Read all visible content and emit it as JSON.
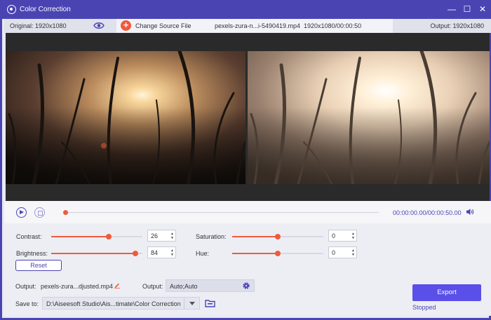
{
  "window": {
    "title": "Color Correction",
    "controls": [
      "—",
      "☐",
      "✕"
    ]
  },
  "infobar": {
    "original_label": "Original: 1920x1080",
    "change_source_label": "Change Source File",
    "file_name": "pexels-zura-n...i-5490419.mp4",
    "file_info": "1920x1080/00:00:50",
    "output_label": "Output: 1920x1080"
  },
  "playback": {
    "current_time": "00:00:00.00",
    "total_time": "/00:00:50.00",
    "progress": 0.0
  },
  "adjustments": {
    "contrast": {
      "label": "Contrast:",
      "value": "26",
      "level": 0.63
    },
    "brightness": {
      "label": "Brightness:",
      "value": "84",
      "level": 0.92
    },
    "saturation": {
      "label": "Saturation:",
      "value": "0",
      "level": 0.5
    },
    "hue": {
      "label": "Hue:",
      "value": "0",
      "level": 0.5
    },
    "reset_label": "Reset"
  },
  "output": {
    "output_label": "Output:",
    "output_file": "pexels-zura...djusted.mp4",
    "format_label": "Output:",
    "format_value": "Auto;Auto",
    "save_to_label": "Save to:",
    "save_path": "D:\\Aiseesoft Studio\\Ais...timate\\Color Correction",
    "export_label": "Export",
    "status": "Stopped"
  },
  "colors": {
    "accent": "#4a44b3",
    "slider": "#f05a3a",
    "export": "#5a4fe8"
  }
}
